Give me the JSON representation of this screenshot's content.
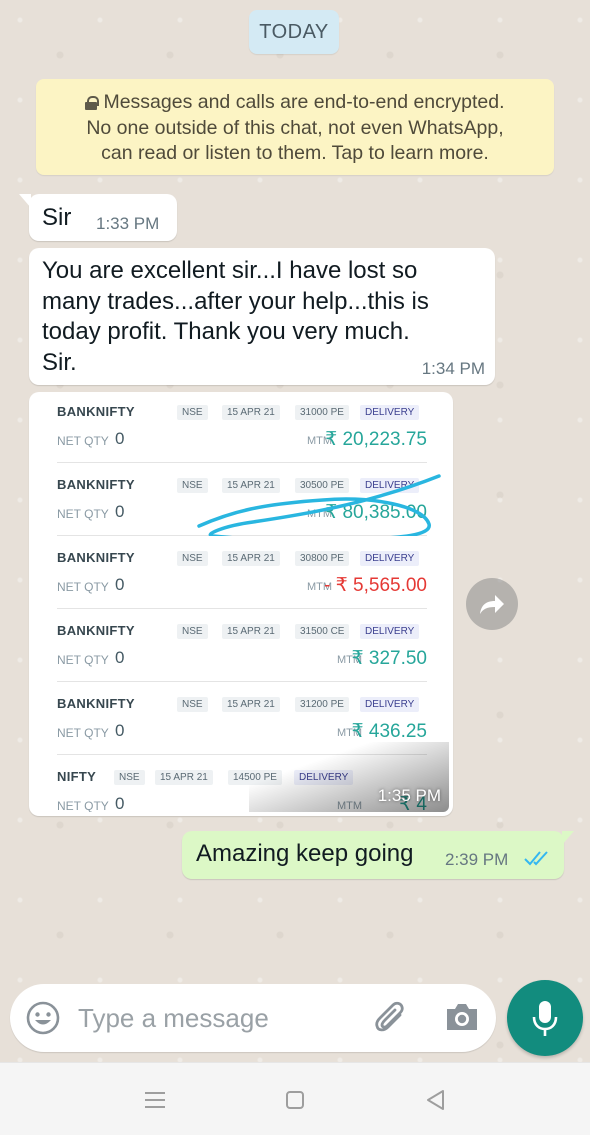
{
  "date_chip": "TODAY",
  "encryption_notice": {
    "line1": "Messages and calls are end-to-end encrypted.",
    "line2": "No one outside of this chat, not even WhatsApp,",
    "line3": "can read or listen to them. Tap to learn more."
  },
  "messages": [
    {
      "text": "Sir",
      "time": "1:33 PM"
    },
    {
      "line1": "You are excellent sir...I have lost so",
      "line2": "many trades...after your help...this is",
      "line3": "today profit. Thank you very much.",
      "line4": "Sir.",
      "time": "1:34 PM"
    },
    {
      "time": "1:35 PM"
    },
    {
      "text": "Amazing keep going",
      "time": "2:39 PM"
    }
  ],
  "positions": [
    {
      "symbol": "BANKNIFTY",
      "exchange": "NSE",
      "expiry": "15 APR 21",
      "strike": "31000 PE",
      "product": "DELIVERY",
      "net_qty_label": "NET QTY",
      "net_qty": "0",
      "mtm_label": "MTM",
      "mtm": "₹ 20,223.75"
    },
    {
      "symbol": "BANKNIFTY",
      "exchange": "NSE",
      "expiry": "15 APR 21",
      "strike": "30500 PE",
      "product": "DELIVERY",
      "net_qty_label": "NET QTY",
      "net_qty": "0",
      "mtm_label": "MTM",
      "mtm": "₹ 80,385.00"
    },
    {
      "symbol": "BANKNIFTY",
      "exchange": "NSE",
      "expiry": "15 APR 21",
      "strike": "30800 PE",
      "product": "DELIVERY",
      "net_qty_label": "NET QTY",
      "net_qty": "0",
      "mtm_label": "MTM",
      "mtm": "- ₹ 5,565.00"
    },
    {
      "symbol": "BANKNIFTY",
      "exchange": "NSE",
      "expiry": "15 APR 21",
      "strike": "31500 CE",
      "product": "DELIVERY",
      "net_qty_label": "NET QTY",
      "net_qty": "0",
      "mtm_label": "MTM",
      "mtm": "₹ 327.50"
    },
    {
      "symbol": "BANKNIFTY",
      "exchange": "NSE",
      "expiry": "15 APR 21",
      "strike": "31200 PE",
      "product": "DELIVERY",
      "net_qty_label": "NET QTY",
      "net_qty": "0",
      "mtm_label": "MTM",
      "mtm": "₹ 436.25"
    },
    {
      "symbol": "NIFTY",
      "exchange": "NSE",
      "expiry": "15 APR 21",
      "strike": "14500 PE",
      "product": "DELIVERY",
      "net_qty_label": "NET QTY",
      "net_qty": "0",
      "mtm_label": "MTM",
      "mtm": "₹ 4"
    }
  ],
  "input": {
    "placeholder": "Type a message",
    "value": ""
  },
  "icons": {
    "emoji": "emoji-icon",
    "attach": "paperclip-icon",
    "camera": "camera-icon",
    "mic": "microphone-icon",
    "forward": "forward-icon",
    "read_receipt": "double-check-icon"
  },
  "colors": {
    "accent": "#128c7e",
    "outgoing_bubble": "#dcf8c6",
    "read_tick": "#34b7f1",
    "profit": "#26a69a",
    "loss": "#e53935",
    "notice_bg": "#fcf4c4"
  }
}
